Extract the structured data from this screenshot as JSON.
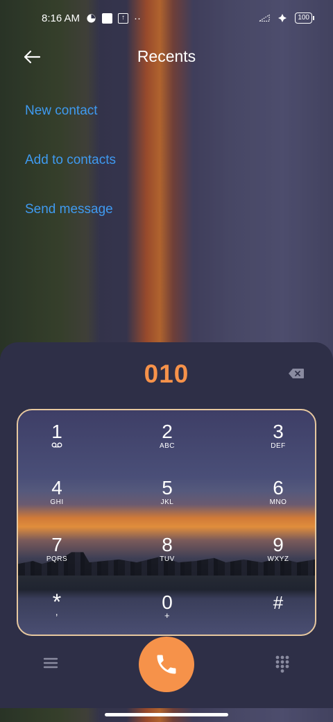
{
  "status_bar": {
    "time": "8:16 AM",
    "battery": "100",
    "more_dots": "··"
  },
  "header": {
    "title": "Recents"
  },
  "actions": {
    "new_contact": "New contact",
    "add_to_contacts": "Add to contacts",
    "send_message": "Send message"
  },
  "dialer": {
    "number": "010",
    "keys": [
      {
        "digit": "1",
        "letters": ""
      },
      {
        "digit": "2",
        "letters": "ABC"
      },
      {
        "digit": "3",
        "letters": "DEF"
      },
      {
        "digit": "4",
        "letters": "GHI"
      },
      {
        "digit": "5",
        "letters": "JKL"
      },
      {
        "digit": "6",
        "letters": "MNO"
      },
      {
        "digit": "7",
        "letters": "PQRS"
      },
      {
        "digit": "8",
        "letters": "TUV"
      },
      {
        "digit": "9",
        "letters": "WXYZ"
      },
      {
        "digit": "*",
        "letters": ","
      },
      {
        "digit": "0",
        "letters": "+"
      },
      {
        "digit": "#",
        "letters": ""
      }
    ]
  },
  "colors": {
    "accent": "#f6924a",
    "link": "#3f9af0",
    "sheet": "#2e2f47"
  }
}
